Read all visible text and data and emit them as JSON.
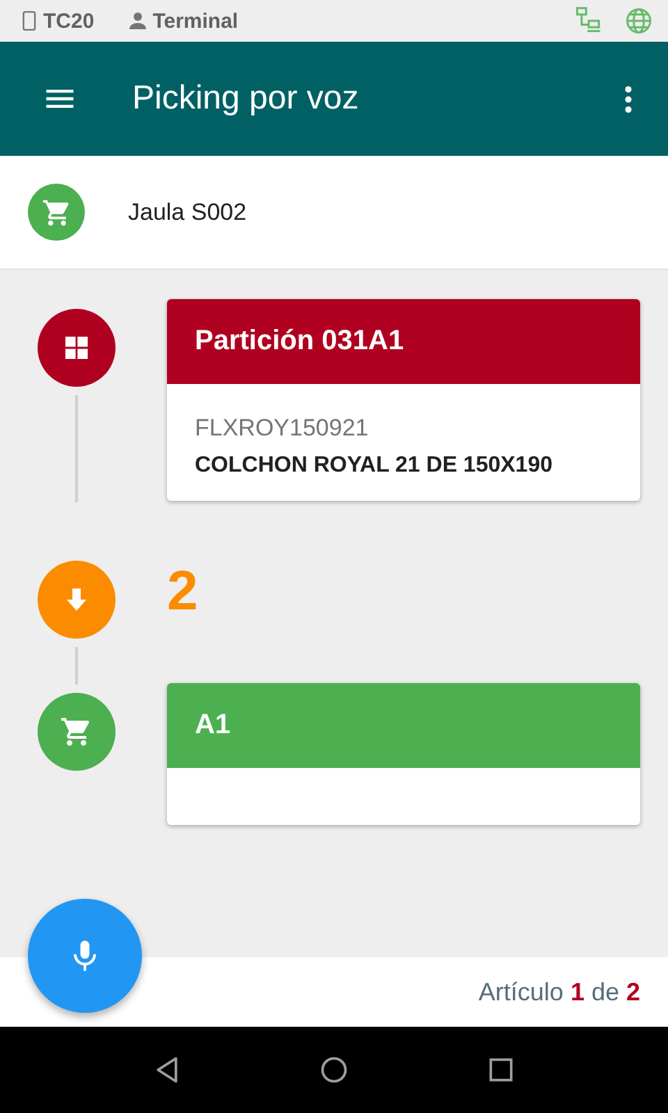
{
  "status_bar": {
    "device": "TC20",
    "user": "Terminal"
  },
  "app_bar": {
    "title": "Picking por voz"
  },
  "header": {
    "label": "Jaula S002"
  },
  "steps": [
    {
      "kind": "partition",
      "color": "#b00020",
      "title": "Partición 031A1",
      "code": "FLXROY150921",
      "description": "COLCHON ROYAL 21 DE 150X190"
    },
    {
      "kind": "quantity",
      "color": "#fb8c00",
      "value": "2"
    },
    {
      "kind": "location",
      "color": "#4caf50",
      "title": "A1"
    }
  ],
  "footer": {
    "counter": "Artículo **1** de **2**"
  }
}
